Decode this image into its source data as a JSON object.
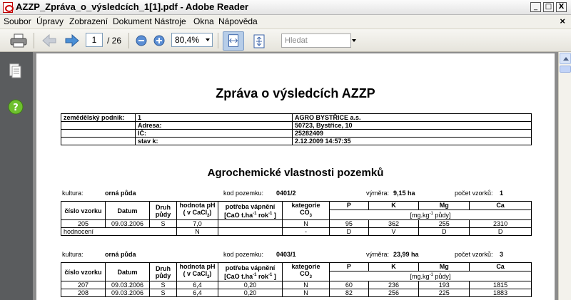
{
  "window": {
    "title": "AZZP_Zpráva_o_výsledcích_1[1].pdf - Adobe Reader",
    "min_label": "_",
    "max_label": "□",
    "close_label": "X"
  },
  "menu": {
    "items": [
      "Soubor",
      "Úpravy",
      "Zobrazení",
      "Dokument",
      "Nástroje",
      "Okna",
      "Nápověda"
    ],
    "close_doc": "×"
  },
  "toolbar": {
    "page_current": "1",
    "page_total": "/ 26",
    "zoom": "80,4%",
    "search_placeholder": "Hledat"
  },
  "document": {
    "title": "Zpráva o výsledcích AZZP",
    "info": {
      "label": "zemědělský podnik:",
      "id": "1",
      "name": "AGRO BYSTŘICE a.s.",
      "adresa_label": "Adresa:",
      "adresa": "50723, Bystřice, 10",
      "ic_label": "IČ:",
      "ic": "25282409",
      "stav_label": "stav k:",
      "stav": "2.12.2009 14:57:35"
    },
    "section_title": "Agrochemické vlastnosti pozemků",
    "headers": {
      "cislo": "číslo vzorku",
      "datum": "Datum",
      "druh": "Druh půdy",
      "ph": "hodnota pH",
      "ph_sub": "( v CaCl",
      "ph_sub2": "2",
      "ph_end": ")",
      "vapneni": "potřeba vápnění",
      "vapneni_unit": "[CaO t.ha",
      "vapneni_exp": "-1",
      "vapneni_unit2": " rok",
      "vapneni_exp2": "-1",
      "vapneni_end": " ]",
      "kategorie": "kategorie",
      "kategorie2": "CO",
      "kategorie_sub": "3",
      "p": "P",
      "k": "K",
      "mg": "Mg",
      "ca": "Ca",
      "unit": "[mg.kg",
      "unit_exp": "-1",
      "unit_end": " půdy]"
    },
    "plots": [
      {
        "kultura_label": "kultura:",
        "kultura": "orná půda",
        "kod_label": "kod pozemku:",
        "kod": "0401/2",
        "vymera_label": "výměra:",
        "vymera": "9,15 ha",
        "pocet_label": "počet vzorků:",
        "pocet": "1",
        "rows": [
          {
            "cislo": "205",
            "datum": "09.03.2006",
            "druh": "S",
            "ph": "7,0",
            "vapneni": "",
            "kategorie": "N",
            "p": "95",
            "k": "362",
            "mg": "255",
            "ca": "2310"
          }
        ],
        "hodnoceni": {
          "label": "hodnocení",
          "ph": "N",
          "kategorie": "-",
          "p": "D",
          "k": "V",
          "mg": "D",
          "ca": "D"
        }
      },
      {
        "kultura_label": "kultura:",
        "kultura": "orná půda",
        "kod_label": "kod pozemku:",
        "kod": "0403/1",
        "vymera_label": "výměra:",
        "vymera": "23,99 ha",
        "pocet_label": "počet vzorků:",
        "pocet": "3",
        "rows": [
          {
            "cislo": "207",
            "datum": "09.03.2006",
            "druh": "S",
            "ph": "6,4",
            "vapneni": "0,20",
            "kategorie": "N",
            "p": "60",
            "k": "236",
            "mg": "193",
            "ca": "1815"
          },
          {
            "cislo": "208",
            "datum": "09.03.2006",
            "druh": "S",
            "ph": "6,4",
            "vapneni": "0,20",
            "kategorie": "N",
            "p": "82",
            "k": "256",
            "mg": "225",
            "ca": "1883"
          }
        ]
      }
    ]
  }
}
